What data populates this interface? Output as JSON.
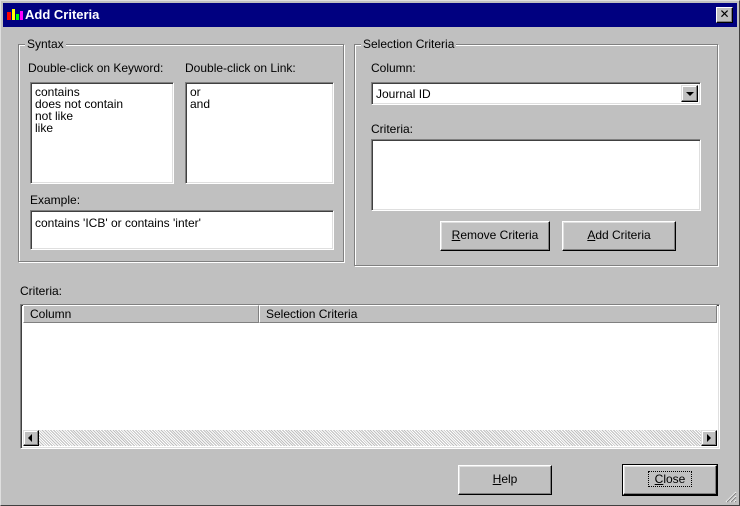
{
  "window": {
    "title": "Add Criteria",
    "close_glyph": "✕",
    "title_bar_color": "#000080",
    "face_color": "#c0c0c0",
    "icon": "app-icon"
  },
  "syntax": {
    "legend": "Syntax",
    "keyword_label": "Double-click on Keyword:",
    "link_label": "Double-click on Link:",
    "keywords": [
      "contains",
      "does not contain",
      "not like",
      "like"
    ],
    "links": [
      "or",
      "and"
    ],
    "example_label": "Example:",
    "example_value": "contains 'ICB' or contains 'inter'"
  },
  "selection": {
    "legend": "Selection Criteria",
    "column_label": "Column:",
    "column_value": "Journal ID",
    "criteria_label": "Criteria:",
    "criteria_value": "",
    "remove_button": {
      "mnemonic": "R",
      "rest": "emove Criteria"
    },
    "add_button": {
      "mnemonic": "A",
      "rest": "dd Criteria"
    }
  },
  "criteria_list": {
    "label": "Criteria:",
    "columns": [
      "Column",
      "Selection Criteria"
    ],
    "rows": []
  },
  "footer": {
    "help_button": {
      "mnemonic": "H",
      "rest": "elp"
    },
    "close_button": {
      "mnemonic": "C",
      "rest": "lose"
    }
  }
}
